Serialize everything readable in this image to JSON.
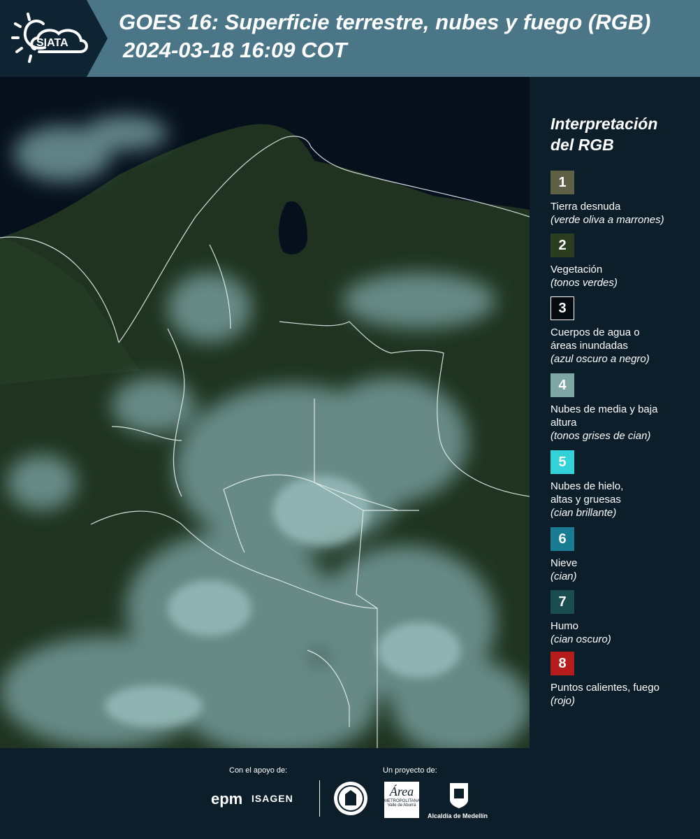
{
  "header": {
    "logo_text": "SIATA",
    "title": "GOES 16: Superficie terrestre, nubes y fuego (RGB)",
    "datetime": "2024-03-18 16:09 COT"
  },
  "legend": {
    "title_line1": "Interpretación",
    "title_line2": "del RGB",
    "items": [
      {
        "number": "1",
        "color": "#5f6045",
        "label": "Tierra desnuda",
        "sub": "(verde oliva a marrones)"
      },
      {
        "number": "2",
        "color": "#2b3d1f",
        "label": "Vegetación",
        "sub": "(tonos verdes)"
      },
      {
        "number": "3",
        "color": "#050a10",
        "label": "Cuerpos de agua o áreas inundadas",
        "sub": "(azul oscuro a negro)"
      },
      {
        "number": "4",
        "color": "#7ea6a4",
        "label": "Nubes de media y baja altura",
        "sub": "(tonos grises de cian)"
      },
      {
        "number": "5",
        "color": "#33d2d8",
        "label": "Nubes de hielo, altas y gruesas",
        "sub": "(cian brillante)"
      },
      {
        "number": "6",
        "color": "#1a7c93",
        "label": "Nieve",
        "sub": "(cian)"
      },
      {
        "number": "7",
        "color": "#1a4d50",
        "label": "Humo",
        "sub": "(cian oscuro)"
      },
      {
        "number": "8",
        "color": "#b71c1c",
        "label": "Puntos calientes, fuego",
        "sub": "(rojo)"
      }
    ]
  },
  "footer": {
    "support_label": "Con el apoyo de:",
    "project_label": "Un proyecto de:",
    "epm": "epm",
    "isagen": "ISAGEN",
    "area_text": "Área",
    "area_sub": "METROPOLITANA",
    "area_sub2": "Valle de Aburrá",
    "alcaldia": "Alcaldía de Medellín"
  }
}
